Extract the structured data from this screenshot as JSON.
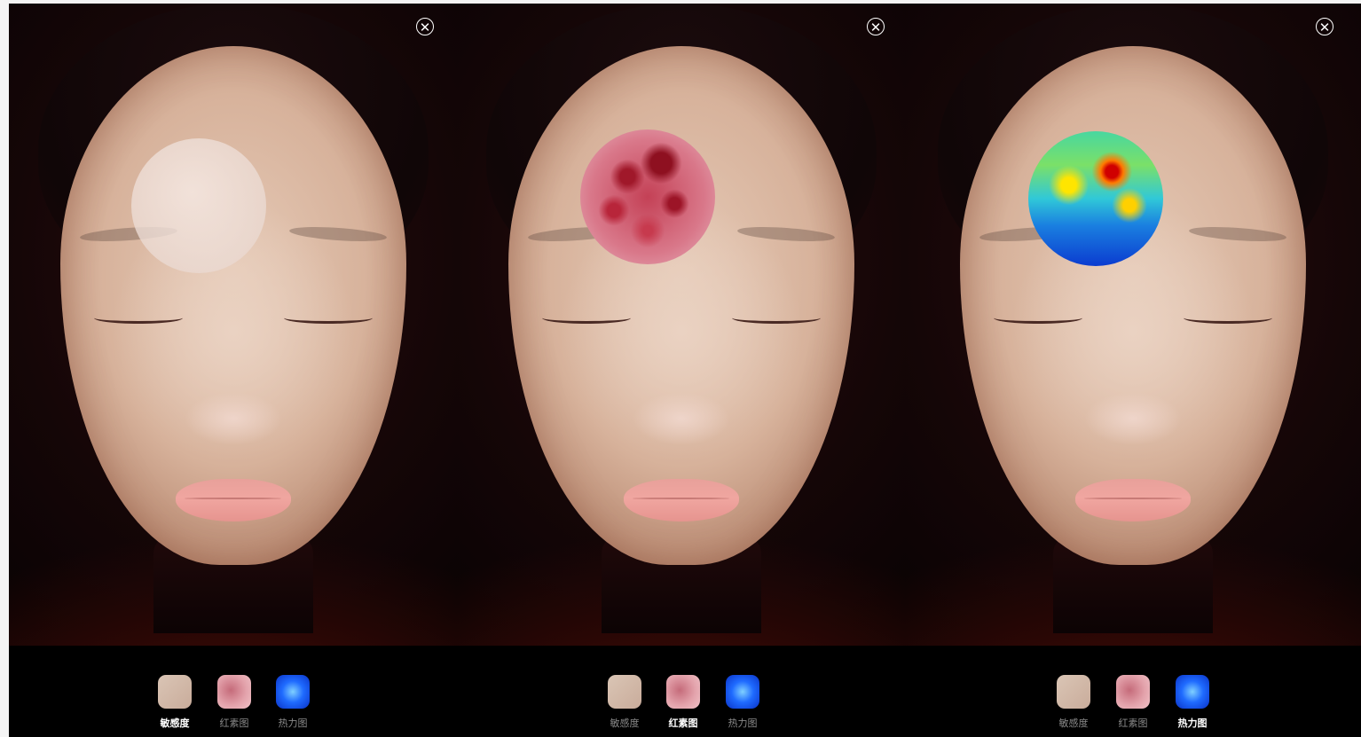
{
  "panels": [
    {
      "lens_mode": "sensitivity",
      "active_tool": 0,
      "tools": [
        {
          "label": "敏感度",
          "icon": "sensitivity-thumbnail-icon"
        },
        {
          "label": "红素图",
          "icon": "redness-map-thumbnail-icon"
        },
        {
          "label": "热力图",
          "icon": "heatmap-thumbnail-icon"
        }
      ]
    },
    {
      "lens_mode": "redness",
      "active_tool": 1,
      "tools": [
        {
          "label": "敏感度",
          "icon": "sensitivity-thumbnail-icon"
        },
        {
          "label": "红素图",
          "icon": "redness-map-thumbnail-icon"
        },
        {
          "label": "热力图",
          "icon": "heatmap-thumbnail-icon"
        }
      ]
    },
    {
      "lens_mode": "heatmap",
      "active_tool": 2,
      "tools": [
        {
          "label": "敏感度",
          "icon": "sensitivity-thumbnail-icon"
        },
        {
          "label": "红素图",
          "icon": "redness-map-thumbnail-icon"
        },
        {
          "label": "热力图",
          "icon": "heatmap-thumbnail-icon"
        }
      ]
    }
  ],
  "close_glyph": "✕",
  "colors": {
    "background": "#000000",
    "active_label": "#ffffff",
    "inactive_label": "#8a8a8a"
  }
}
